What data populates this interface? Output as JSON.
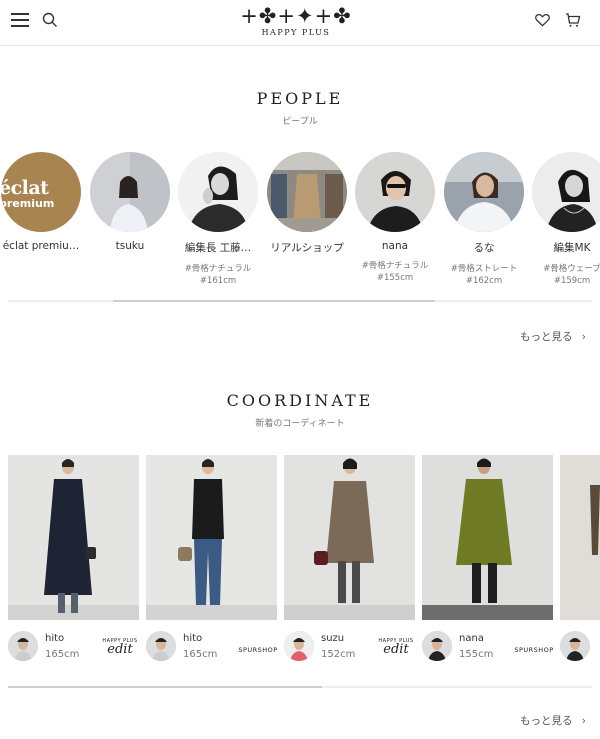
{
  "header": {
    "logo_marks": "+✤+✦+✤",
    "logo_text": "HAPPY PLUS"
  },
  "people": {
    "title": "PEOPLE",
    "subtitle": "ピープル",
    "items": [
      {
        "name": "éclat premiu…",
        "tag": "",
        "height": "",
        "avatar_text_top": "éclat",
        "avatar_text_bottom": "premium"
      },
      {
        "name": "tsuku",
        "tag": "",
        "height": ""
      },
      {
        "name": "編集長 工藤…",
        "tag": "#骨格ナチュラル",
        "height": "#161cm"
      },
      {
        "name": "リアルショップ",
        "tag": "",
        "height": ""
      },
      {
        "name": "nana",
        "tag": "#骨格ナチュラル",
        "height": "#155cm"
      },
      {
        "name": "るな",
        "tag": "#骨格ストレート",
        "height": "#162cm"
      },
      {
        "name": "編集MK",
        "tag": "#骨格ウェーブ",
        "height": "#159cm"
      }
    ],
    "more": "もっと見る",
    "scroll_fraction": 0.55
  },
  "coordinate": {
    "title": "COORDINATE",
    "subtitle": "新着のコーディネート",
    "items": [
      {
        "name": "hito",
        "height": "165cm",
        "brand_type": "edit",
        "brand_top": "HAPPY PLUS",
        "brand_main": "edit",
        "coat_color": "#1e2433"
      },
      {
        "name": "hito",
        "height": "165cm",
        "brand_type": "spur",
        "brand_main": "SPURSHOP",
        "coat_color": "#1b1b1b"
      },
      {
        "name": "suzu",
        "height": "152cm",
        "brand_type": "edit",
        "brand_top": "HAPPY PLUS",
        "brand_main": "edit",
        "coat_color": "#7c6a58"
      },
      {
        "name": "nana",
        "height": "155cm",
        "brand_type": "spur",
        "brand_main": "SPURSHOP",
        "coat_color": "#6f7a24"
      },
      {
        "name": "",
        "height": "",
        "brand_type": "",
        "coat_color": "#e0ddd8"
      }
    ],
    "more": "もっと見る",
    "scroll_fraction": 0.52
  }
}
